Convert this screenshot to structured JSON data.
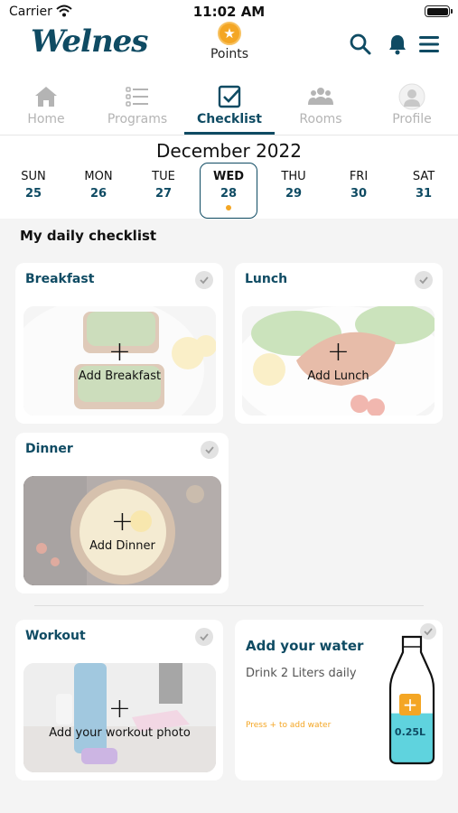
{
  "status_bar": {
    "carrier": "Carrier",
    "time": "11:02 AM"
  },
  "header": {
    "logo": "Welnes",
    "points_label": "Points"
  },
  "tabs": [
    {
      "label": "Home",
      "icon": "home-icon"
    },
    {
      "label": "Programs",
      "icon": "programs-icon"
    },
    {
      "label": "Checklist",
      "icon": "checklist-icon",
      "active": true
    },
    {
      "label": "Rooms",
      "icon": "rooms-icon"
    },
    {
      "label": "Profile",
      "icon": "profile-icon"
    }
  ],
  "calendar": {
    "month": "December 2022",
    "days": [
      {
        "name": "SUN",
        "num": "25"
      },
      {
        "name": "MON",
        "num": "26"
      },
      {
        "name": "TUE",
        "num": "27"
      },
      {
        "name": "WED",
        "num": "28",
        "selected": true
      },
      {
        "name": "THU",
        "num": "29"
      },
      {
        "name": "FRI",
        "num": "30"
      },
      {
        "name": "SAT",
        "num": "31"
      }
    ]
  },
  "checklist": {
    "title": "My daily checklist",
    "breakfast": {
      "title": "Breakfast",
      "add_label": "Add Breakfast"
    },
    "lunch": {
      "title": "Lunch",
      "add_label": "Add Lunch"
    },
    "dinner": {
      "title": "Dinner",
      "add_label": "Add Dinner"
    },
    "workout": {
      "title": "Workout",
      "add_label": "Add your workout photo"
    },
    "water": {
      "title": "Add your water",
      "subtitle": "Drink 2 Liters daily",
      "hint": "Press + to add water",
      "amount": "0.25L",
      "fill_fraction": 0.125
    }
  },
  "colors": {
    "brand": "#0f4b63",
    "accent": "#f4a624",
    "water": "#5fd3de"
  }
}
